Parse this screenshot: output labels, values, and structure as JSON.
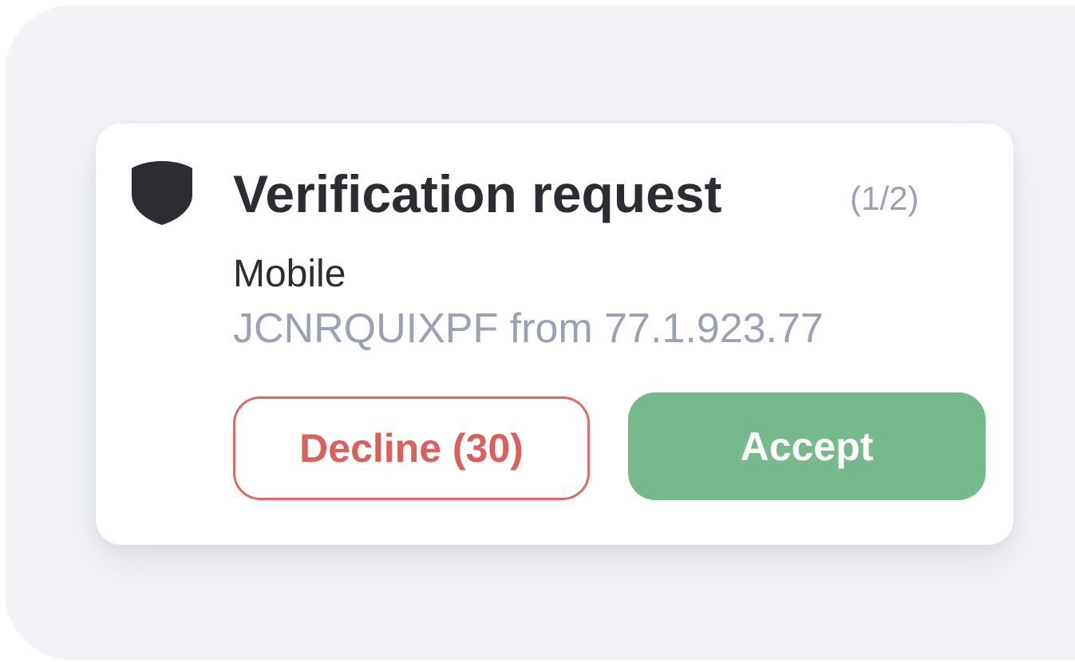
{
  "notification": {
    "title": "Verification request",
    "counter": "(1/2)",
    "device": "Mobile",
    "origin": "JCNRQUIXPF from 77.1.923.77",
    "icon": "shield-icon"
  },
  "actions": {
    "decline_label": "Decline (30)",
    "accept_label": "Accept"
  },
  "colors": {
    "background": "#f3f4f8",
    "card": "#ffffff",
    "title_text": "#2b2d32",
    "muted_text": "#9aa1b3",
    "decline": "#de6b67",
    "accept": "#76b98d"
  }
}
